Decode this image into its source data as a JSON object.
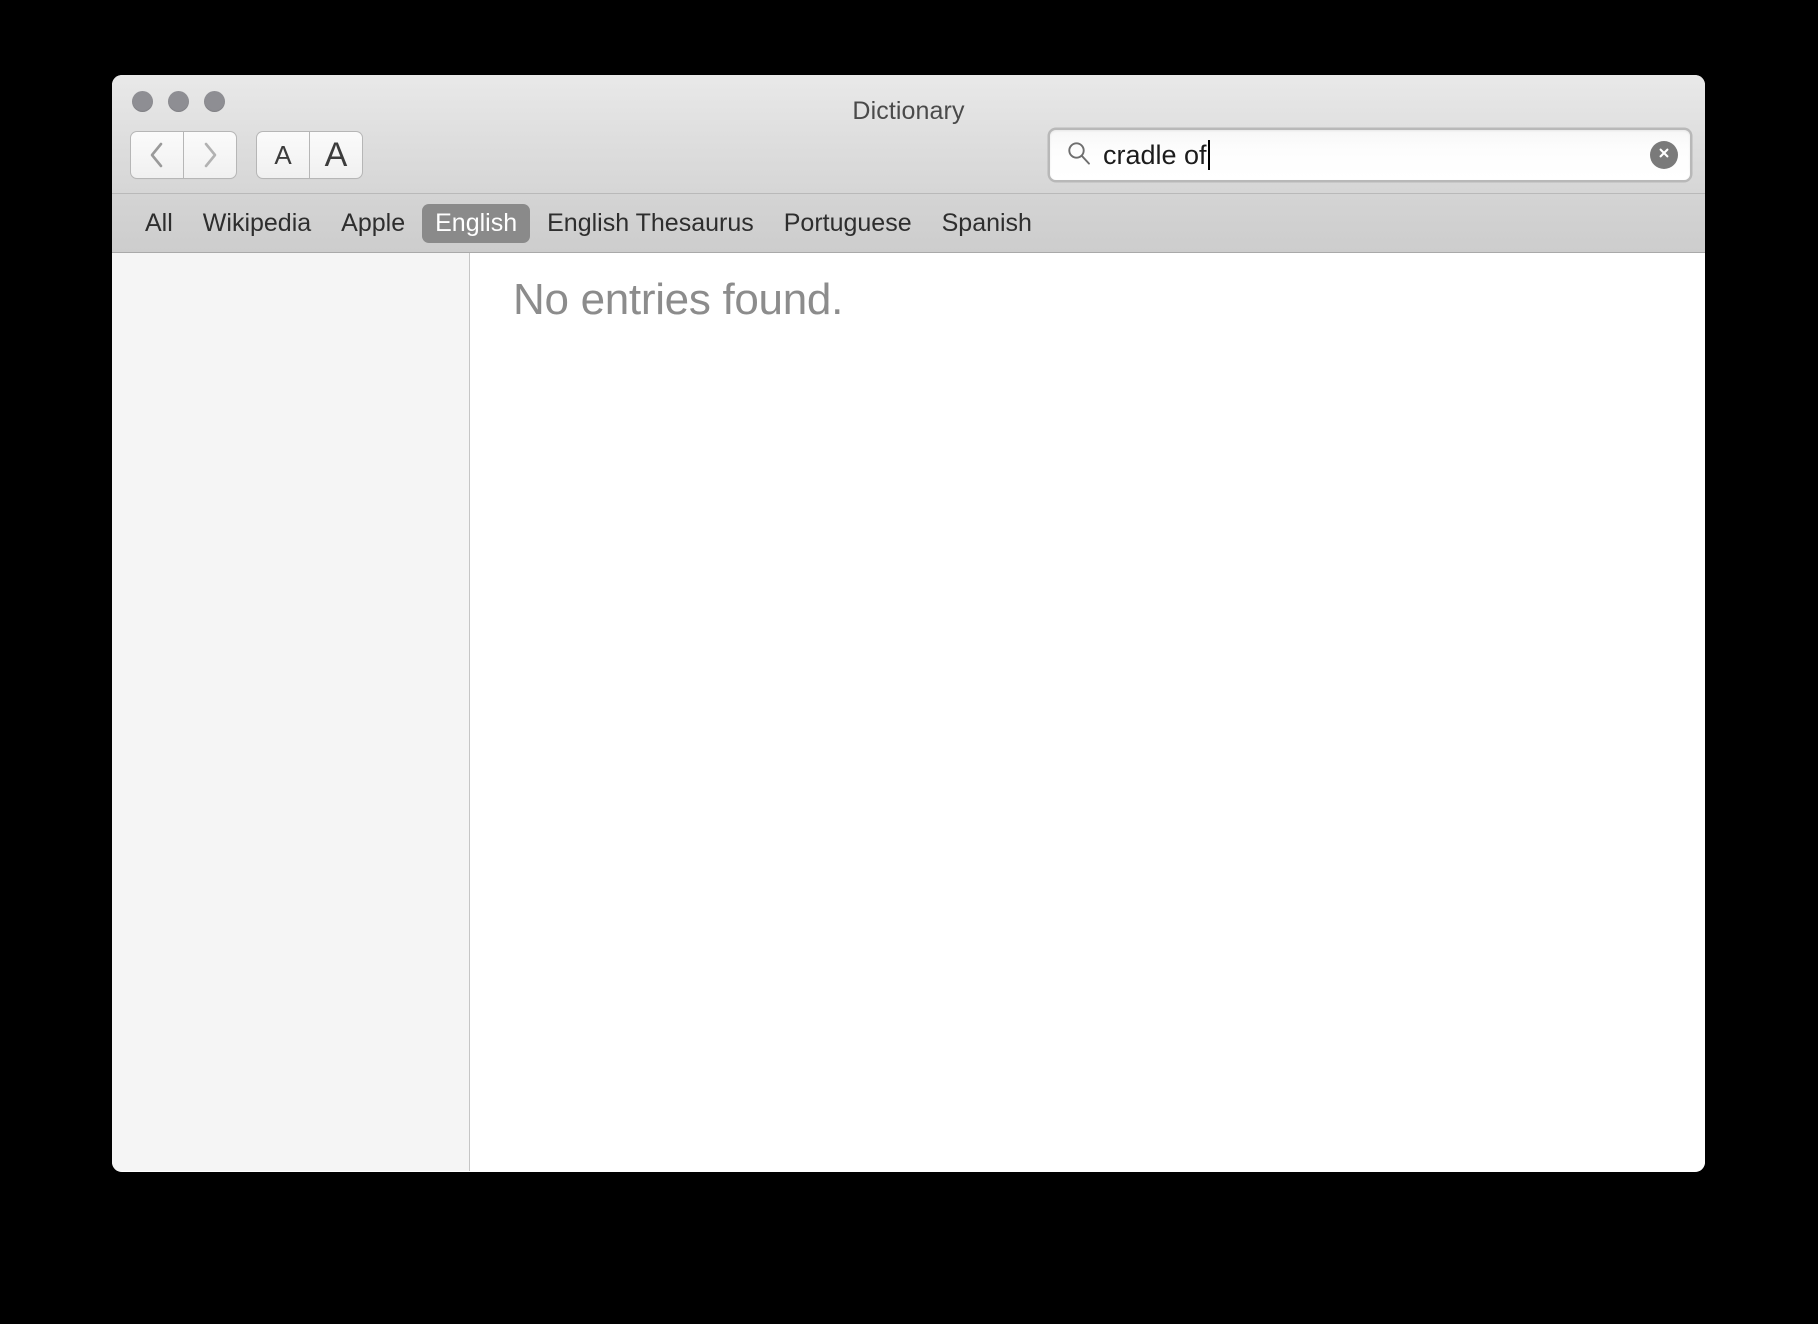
{
  "window": {
    "title": "Dictionary",
    "traffic_lights": [
      {
        "name": "close",
        "color": "#8e8e93"
      },
      {
        "name": "minimize",
        "color": "#8e8e93"
      },
      {
        "name": "zoom",
        "color": "#8e8e93"
      }
    ]
  },
  "toolbar": {
    "back_label": "Back",
    "forward_label": "Forward",
    "font_smaller_label": "A",
    "font_larger_label": "A"
  },
  "search": {
    "value": "cradle of",
    "placeholder": "Search",
    "icon": "search-icon",
    "clear_icon": "clear-circle-icon",
    "has_caret": true
  },
  "tabs": [
    {
      "label": "All",
      "selected": false
    },
    {
      "label": "Wikipedia",
      "selected": false
    },
    {
      "label": "Apple",
      "selected": false
    },
    {
      "label": "English",
      "selected": true
    },
    {
      "label": "English Thesaurus",
      "selected": false
    },
    {
      "label": "Portuguese",
      "selected": false
    },
    {
      "label": "Spanish",
      "selected": false
    }
  ],
  "sidebar": {
    "items": []
  },
  "content": {
    "message": "No entries found."
  },
  "colors": {
    "selected_tab_bg": "#8a8a8a",
    "titlebar_top": "#e9e9e9",
    "tabbar_bg": "#d0d0d0",
    "sidebar_bg": "#f5f5f5",
    "message_text": "#8c8c8c"
  }
}
